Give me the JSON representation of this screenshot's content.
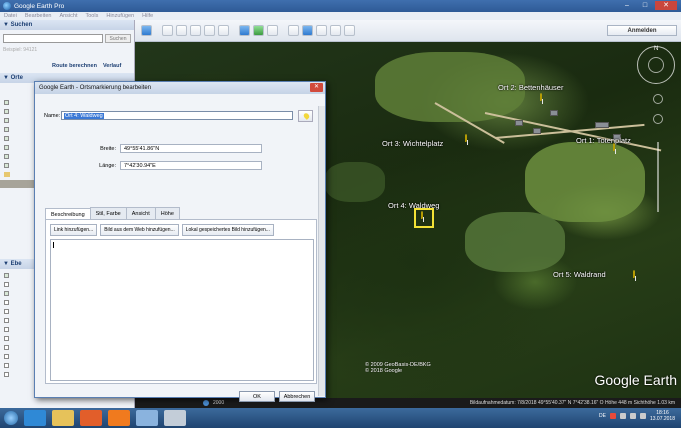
{
  "app": {
    "title": "Google Earth Pro"
  },
  "menu": [
    "Datei",
    "Bearbeiten",
    "Ansicht",
    "Tools",
    "Hinzufügen",
    "Hilfe"
  ],
  "toolbar": {
    "signin_label": "Anmelden"
  },
  "search": {
    "header": "▼ Suchen",
    "button": "Suchen",
    "example": "Beispiel: 94121",
    "link_route": "Route berechnen",
    "link_history": "Verlauf"
  },
  "places": {
    "header": "▼ Orte"
  },
  "layers": {
    "header": "▼ Ebe"
  },
  "map": {
    "labels": {
      "ort2": "Ort 2: Bettenhäuser",
      "ort3": "Ort 3: Wichtelplatz",
      "ort1": "Ort 1: Totenplatz",
      "ort4": "Ort 4: Waldweg",
      "ort5": "Ort 5: Waldrand"
    },
    "copyright_line1": "© 2009 GeoBasis-DE/BKG",
    "copyright_line2": "© 2018 Google",
    "logo": "Google Earth",
    "compass_n": "N"
  },
  "status": {
    "tour": "2000",
    "info": "Bildaufnahmedatum: 7/8/2018   49°55'40.37\" N   7°42'38.16\" O   Höhe 448 m    Sichthöhe 1.03 km"
  },
  "taskbar": {
    "lang": "DE",
    "time": "18:16",
    "date": "13.07.2018"
  },
  "dialog": {
    "title": "Google Earth - Ortsmarkierung bearbeiten",
    "close": "✕",
    "name_label": "Name:",
    "name_value": "Ort 4: Waldweg",
    "lat_label": "Breite:",
    "lat_value": "49°55'41.86\"N",
    "lon_label": "Länge:",
    "lon_value": "7°42'30.94\"E",
    "tabs": [
      "Beschreibung",
      "Stil, Farbe",
      "Ansicht",
      "Höhe"
    ],
    "btn_link": "Link hinzufügen...",
    "btn_web_image": "Bild aus dem Web hinzufügen...",
    "btn_local_image": "Lokal gespeichertes Bild hinzufügen...",
    "ok": "OK",
    "cancel": "Abbrechen"
  }
}
